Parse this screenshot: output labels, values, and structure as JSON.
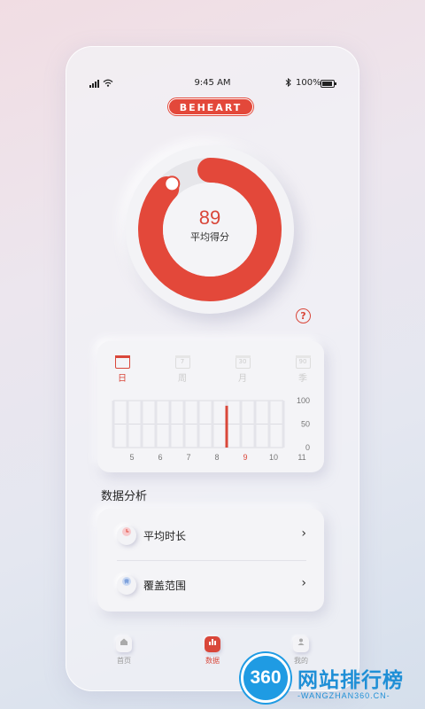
{
  "status": {
    "time": "9:45 AM",
    "battery": "100%"
  },
  "brand": {
    "logo": "BEHEART",
    "accent": "#d9473a"
  },
  "score": {
    "value": "89",
    "label": "平均得分",
    "progress": 0.89
  },
  "help": {
    "symbol": "?"
  },
  "period_tabs": [
    {
      "label": "日",
      "icon_text": "",
      "active": true
    },
    {
      "label": "周",
      "icon_text": "7",
      "active": false
    },
    {
      "label": "月",
      "icon_text": "30",
      "active": false
    },
    {
      "label": "季",
      "icon_text": "90",
      "active": false
    }
  ],
  "chart_data": {
    "type": "bar",
    "x_ticks": [
      "5",
      "6",
      "7",
      "8",
      "9",
      "10",
      "11"
    ],
    "y_ticks": [
      "100",
      "50",
      "0"
    ],
    "ylim": [
      0,
      100
    ],
    "categories": [
      "5",
      "",
      "6",
      "",
      "7",
      "",
      "8",
      "",
      "9",
      "",
      "10",
      "",
      "11"
    ],
    "values": [
      0,
      0,
      0,
      0,
      0,
      0,
      0,
      0,
      89,
      0,
      0,
      0,
      0
    ],
    "highlight_index": 8
  },
  "analysis": {
    "title": "数据分析",
    "items": [
      {
        "label": "平均时长",
        "icon": "clock-icon"
      },
      {
        "label": "覆盖范围",
        "icon": "tooth-icon"
      }
    ]
  },
  "nav": [
    {
      "label": "首页",
      "icon": "home-icon",
      "active": false
    },
    {
      "label": "数据",
      "icon": "chart-icon",
      "active": true
    },
    {
      "label": "我的",
      "icon": "user-icon",
      "active": false
    }
  ],
  "watermark": {
    "badge": "360",
    "text": "网站排行榜",
    "sub": "-WANGZHAN360.CN-"
  }
}
